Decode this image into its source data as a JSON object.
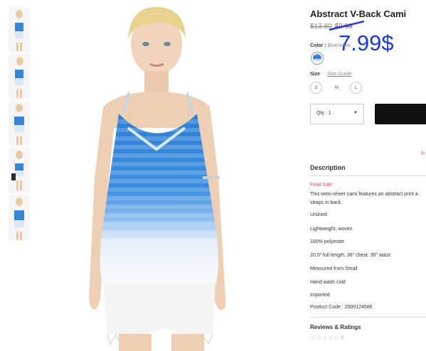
{
  "product": {
    "title": "Abstract V-Back Cami",
    "old_price": "$13.80",
    "sale_price": "$9.99",
    "new_price_annotation": "7.99$",
    "color_label": "Color :",
    "color_name": "Blue/white",
    "size_label": "Size",
    "size_guide": "Size Guide",
    "sizes": [
      "S",
      "M",
      "L"
    ],
    "qty": "Qty : 1",
    "promo_fragment": "Pr"
  },
  "description": {
    "heading": "Description",
    "final_sale": "Final Sale",
    "lines": [
      "This semi-sheer cami features an abstract print a",
      "straps in back.",
      "Unlined",
      "Lightweight, woven",
      "100% polyester",
      "20.5\" full length, 36\" chest, 35\" waist",
      "Measured from Small",
      "Hand wash cold",
      "Imported",
      "Product Code : 2000124586"
    ]
  },
  "reviews": {
    "heading": "Reviews & Ratings",
    "stars": "☆☆☆☆☆",
    "count": "0"
  },
  "colors": {
    "accent_blue": "#2a74c8",
    "sale_red": "#d9534f",
    "annotation_blue": "#1a3adb"
  }
}
